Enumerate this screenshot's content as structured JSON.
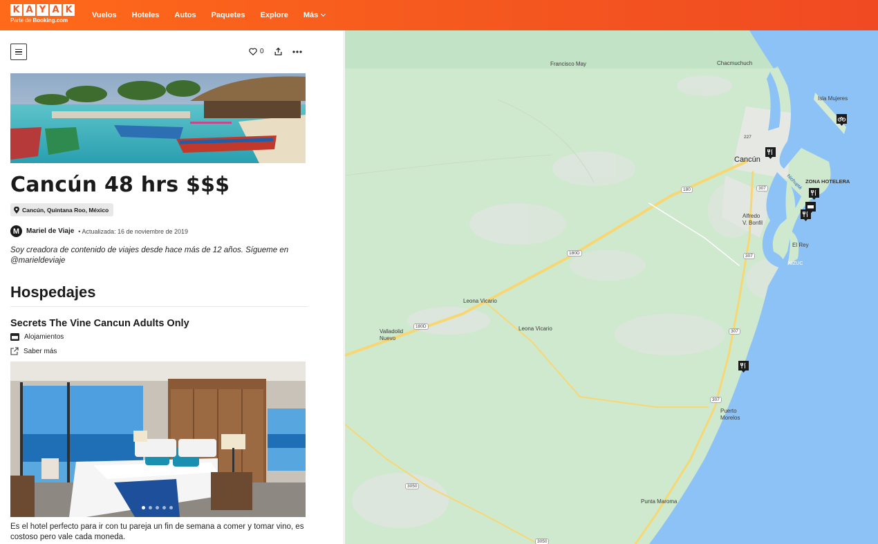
{
  "header": {
    "logo_letters": [
      "K",
      "A",
      "Y",
      "A",
      "K"
    ],
    "logo_sub_prefix": "Parte de ",
    "logo_sub_brand": "Booking.com",
    "nav": [
      "Vuelos",
      "Hoteles",
      "Autos",
      "Paquetes",
      "Explore",
      "Más"
    ]
  },
  "trip": {
    "likes": "0",
    "title": "Cancún 48 hrs $$$",
    "location": "Cancún, Quintana Roo, México",
    "author_initial": "M",
    "author": "Mariel de Viaje",
    "updated": "• Actualizada: 16 de noviembre de 2019",
    "bio": "Soy creadora de contenido de viajes desde hace más de 12 años. Sígueme en @marieldeviaje",
    "section": "Hospedajes",
    "hotel": {
      "name": "Secrets The Vine Cancun Adults Only",
      "category": "Alojamientos",
      "link": "Saber más",
      "photo_count": 5,
      "active_photo": 1,
      "description": "Es el hotel perfecto para ir con tu pareja un fin de semana a comer y tomar vino, es costoso pero vale cada moneda."
    }
  },
  "map": {
    "places": {
      "francisco_may": "Francisco May",
      "chacmuchuch": "Chacmuchuch",
      "isla_mujeres": "Isla Mujeres",
      "cancun": "Cancún",
      "zona_hotelera": "ZONA HOTELERA",
      "alfredo_bonfil": "Alfredo\nV. Bonfil",
      "el_rey": "El Rey",
      "nizuc": "NIZUC",
      "leona_vicario_1": "Leona Vicario",
      "leona_vicario_2": "Leona Vicario",
      "valladolid_nuevo": "Valladolid\nNuevo",
      "puerto_morelos": "Puerto\nMorelos",
      "punta_maroma": "Punta Maroma",
      "nichupte": "Nichupté"
    },
    "road_shields": [
      "180",
      "180D",
      "180D",
      "180",
      "307",
      "307",
      "307",
      "307",
      "227",
      "3050",
      "3050"
    ],
    "colors": {
      "land": "#cfe9cf",
      "water": "#8cc2f5",
      "urban": "#e8ebe6",
      "road": "#f7d774",
      "pin": "#1b1b1b"
    }
  }
}
